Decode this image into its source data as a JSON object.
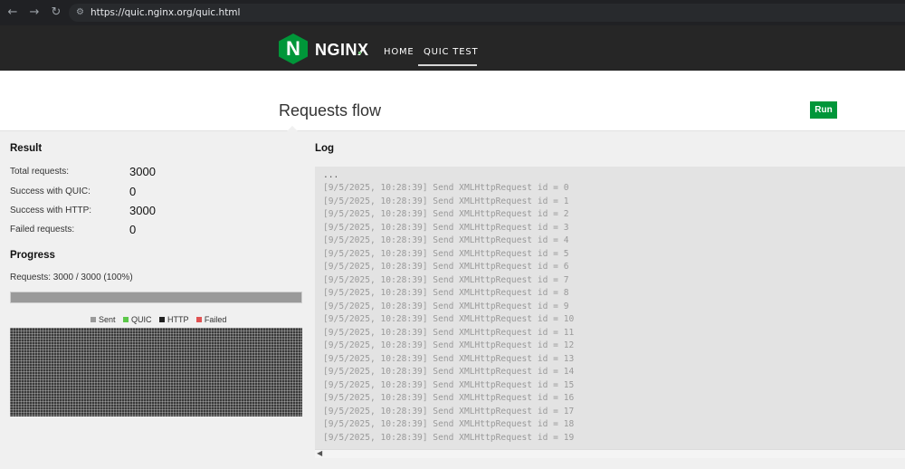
{
  "browser": {
    "url": "https://quic.nginx.org/quic.html",
    "back_icon": "arrow-left-icon",
    "forward_icon": "arrow-right-icon",
    "reload_icon": "reload-icon",
    "site_info_icon": "site-settings-icon"
  },
  "header": {
    "logo_letter": "N",
    "logo_text": "NGINX",
    "nav": [
      {
        "label": "HOME",
        "active": false
      },
      {
        "label": "QUIC TEST",
        "active": true
      }
    ],
    "brand_color": "#009639"
  },
  "page": {
    "title": "Requests flow",
    "run_label": "Run"
  },
  "result": {
    "heading": "Result",
    "rows": [
      {
        "label": "Total requests:",
        "value": "3000"
      },
      {
        "label": "Success with QUIC:",
        "value": "0"
      },
      {
        "label": "Success with HTTP:",
        "value": "3000"
      },
      {
        "label": "Failed requests:",
        "value": "0"
      }
    ]
  },
  "progress": {
    "heading": "Progress",
    "text": "Requests: 3000 / 3000 (100%)",
    "fraction": 1.0,
    "legend": [
      {
        "label": "Sent",
        "color": "#9a9a9a"
      },
      {
        "label": "QUIC",
        "color": "#5cc74a"
      },
      {
        "label": "HTTP",
        "color": "#222222"
      },
      {
        "label": "Failed",
        "color": "#e05252"
      }
    ]
  },
  "log": {
    "heading": "Log",
    "ellipsis": "...",
    "lines": [
      "[9/5/2025, 10:28:39] Send XMLHttpRequest id = 0",
      "[9/5/2025, 10:28:39] Send XMLHttpRequest id = 1",
      "[9/5/2025, 10:28:39] Send XMLHttpRequest id = 2",
      "[9/5/2025, 10:28:39] Send XMLHttpRequest id = 3",
      "[9/5/2025, 10:28:39] Send XMLHttpRequest id = 4",
      "[9/5/2025, 10:28:39] Send XMLHttpRequest id = 5",
      "[9/5/2025, 10:28:39] Send XMLHttpRequest id = 6",
      "[9/5/2025, 10:28:39] Send XMLHttpRequest id = 7",
      "[9/5/2025, 10:28:39] Send XMLHttpRequest id = 8",
      "[9/5/2025, 10:28:39] Send XMLHttpRequest id = 9",
      "[9/5/2025, 10:28:39] Send XMLHttpRequest id = 10",
      "[9/5/2025, 10:28:39] Send XMLHttpRequest id = 11",
      "[9/5/2025, 10:28:39] Send XMLHttpRequest id = 12",
      "[9/5/2025, 10:28:39] Send XMLHttpRequest id = 13",
      "[9/5/2025, 10:28:39] Send XMLHttpRequest id = 14",
      "[9/5/2025, 10:28:39] Send XMLHttpRequest id = 15",
      "[9/5/2025, 10:28:39] Send XMLHttpRequest id = 16",
      "[9/5/2025, 10:28:39] Send XMLHttpRequest id = 17",
      "[9/5/2025, 10:28:39] Send XMLHttpRequest id = 18",
      "[9/5/2025, 10:28:39] Send XMLHttpRequest id = 19"
    ]
  }
}
